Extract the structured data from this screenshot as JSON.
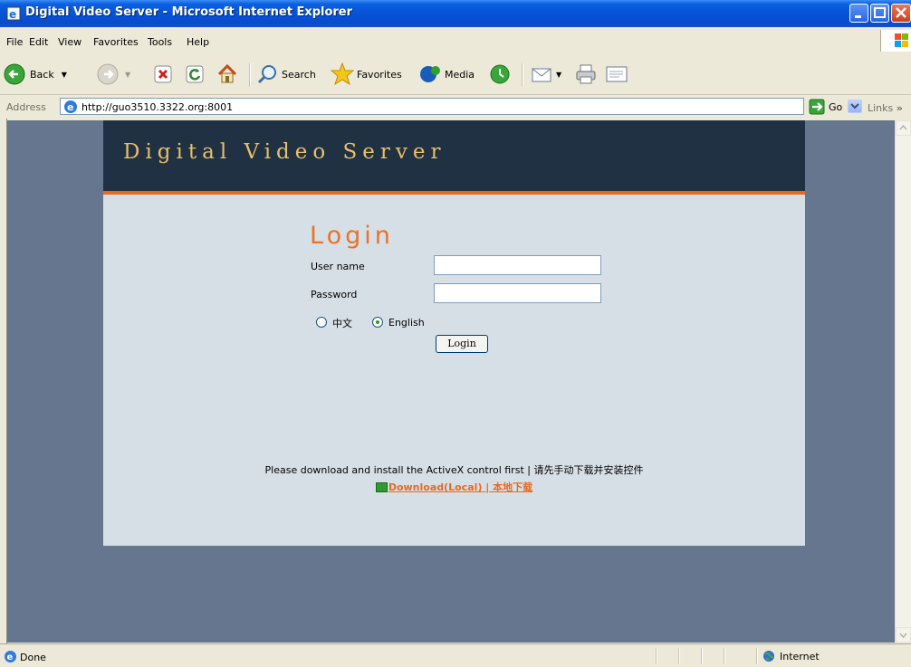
{
  "window": {
    "title": "Digital Video Server - Microsoft Internet Explorer"
  },
  "menu": {
    "items": [
      {
        "label": "File"
      },
      {
        "label": "Edit"
      },
      {
        "label": "View"
      },
      {
        "label": "Favorites"
      },
      {
        "label": "Tools"
      },
      {
        "label": "Help"
      }
    ]
  },
  "toolbar": {
    "back_label": "Back",
    "search_label": "Search",
    "favorites_label": "Favorites",
    "media_label": "Media"
  },
  "address": {
    "label": "Address",
    "url": "http://guo3510.3322.org:8001",
    "go_label": "Go",
    "links_label": "Links"
  },
  "page": {
    "header_title": "Digital Video Server",
    "login_title": "Login",
    "username_label": "User name",
    "password_label": "Password",
    "language_options": [
      {
        "label": "中文",
        "selected": false
      },
      {
        "label": "English",
        "selected": true
      }
    ],
    "login_button": "Login",
    "notice": "Please download and install the ActiveX control first | 请先手动下载并安装控件",
    "download_link": "Download(Local) | 本地下载",
    "colors": {
      "header_bg": "#203143",
      "accent": "#E86A1E",
      "body_bg": "#D7DFE6",
      "outer_bg": "#66768E"
    }
  },
  "status": {
    "text": "Done",
    "zone": "Internet"
  }
}
